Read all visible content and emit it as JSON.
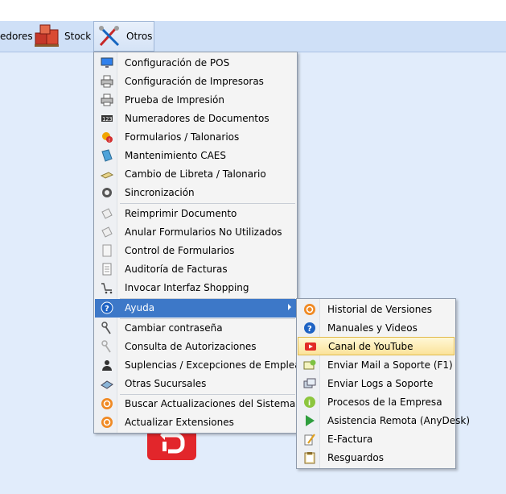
{
  "toolbar": {
    "items": [
      {
        "label": "edores",
        "icon": "none"
      },
      {
        "label": "Stock",
        "icon": "stock-boxes-icon"
      },
      {
        "label": "Otros",
        "icon": "tools-icon"
      }
    ]
  },
  "menu": {
    "items": [
      {
        "label": "Configuración de POS",
        "icon": "monitor-icon"
      },
      {
        "label": "Configuración de Impresoras",
        "icon": "printer-icon"
      },
      {
        "label": "Prueba de Impresión",
        "icon": "printer-icon"
      },
      {
        "label": "Numeradores de Documentos",
        "icon": "counter-icon"
      },
      {
        "label": "Formularios / Talonarios",
        "icon": "gear-warning-icon"
      },
      {
        "label": "Mantenimiento CAES",
        "icon": "book-icon"
      },
      {
        "label": "Cambio de Libreta / Talonario",
        "icon": "notebook-icon"
      },
      {
        "label": "Sincronización",
        "icon": "sync-icon"
      },
      {
        "label": "Reimprimir Documento",
        "icon": "document-icon"
      },
      {
        "label": "Anular Formularios No Utilizados",
        "icon": "document-icon"
      },
      {
        "label": "Control de Formularios",
        "icon": "form-icon"
      },
      {
        "label": "Auditoría de Facturas",
        "icon": "invoice-icon"
      },
      {
        "label": "Invocar Interfaz Shopping",
        "icon": "cart-icon"
      },
      {
        "label": "Ayuda",
        "icon": "help-icon"
      },
      {
        "label": "Cambiar contraseña",
        "icon": "key-icon"
      },
      {
        "label": "Consulta de Autorizaciones",
        "icon": "key-icon"
      },
      {
        "label": "Suplencias / Excepciones de Empleados",
        "icon": "user-icon"
      },
      {
        "label": "Otras Sucursales",
        "icon": "store-icon"
      },
      {
        "label": "Buscar Actualizaciones del Sistema",
        "icon": "update-icon"
      },
      {
        "label": "Actualizar Extensiones",
        "icon": "update-icon"
      }
    ]
  },
  "submenu": {
    "items": [
      {
        "label": "Historial de Versiones",
        "icon": "history-icon"
      },
      {
        "label": "Manuales y Videos",
        "icon": "help-icon"
      },
      {
        "label": "Canal de YouTube",
        "icon": "youtube-icon"
      },
      {
        "label": "Enviar Mail a Soporte (F1)",
        "icon": "mail-icon"
      },
      {
        "label": "Enviar Logs a Soporte",
        "icon": "logs-icon"
      },
      {
        "label": "Procesos de la Empresa",
        "icon": "info-icon"
      },
      {
        "label": "Asistencia Remota (AnyDesk)",
        "icon": "play-icon"
      },
      {
        "label": "E-Factura",
        "icon": "pen-icon"
      },
      {
        "label": "Resguardos",
        "icon": "clipboard-icon"
      }
    ]
  },
  "colors": {
    "background": "#e1ecfb",
    "toolbar": "#cfe0f7",
    "menu_highlight": "#3d78c8",
    "submenu_highlight": "#fbe39a"
  }
}
